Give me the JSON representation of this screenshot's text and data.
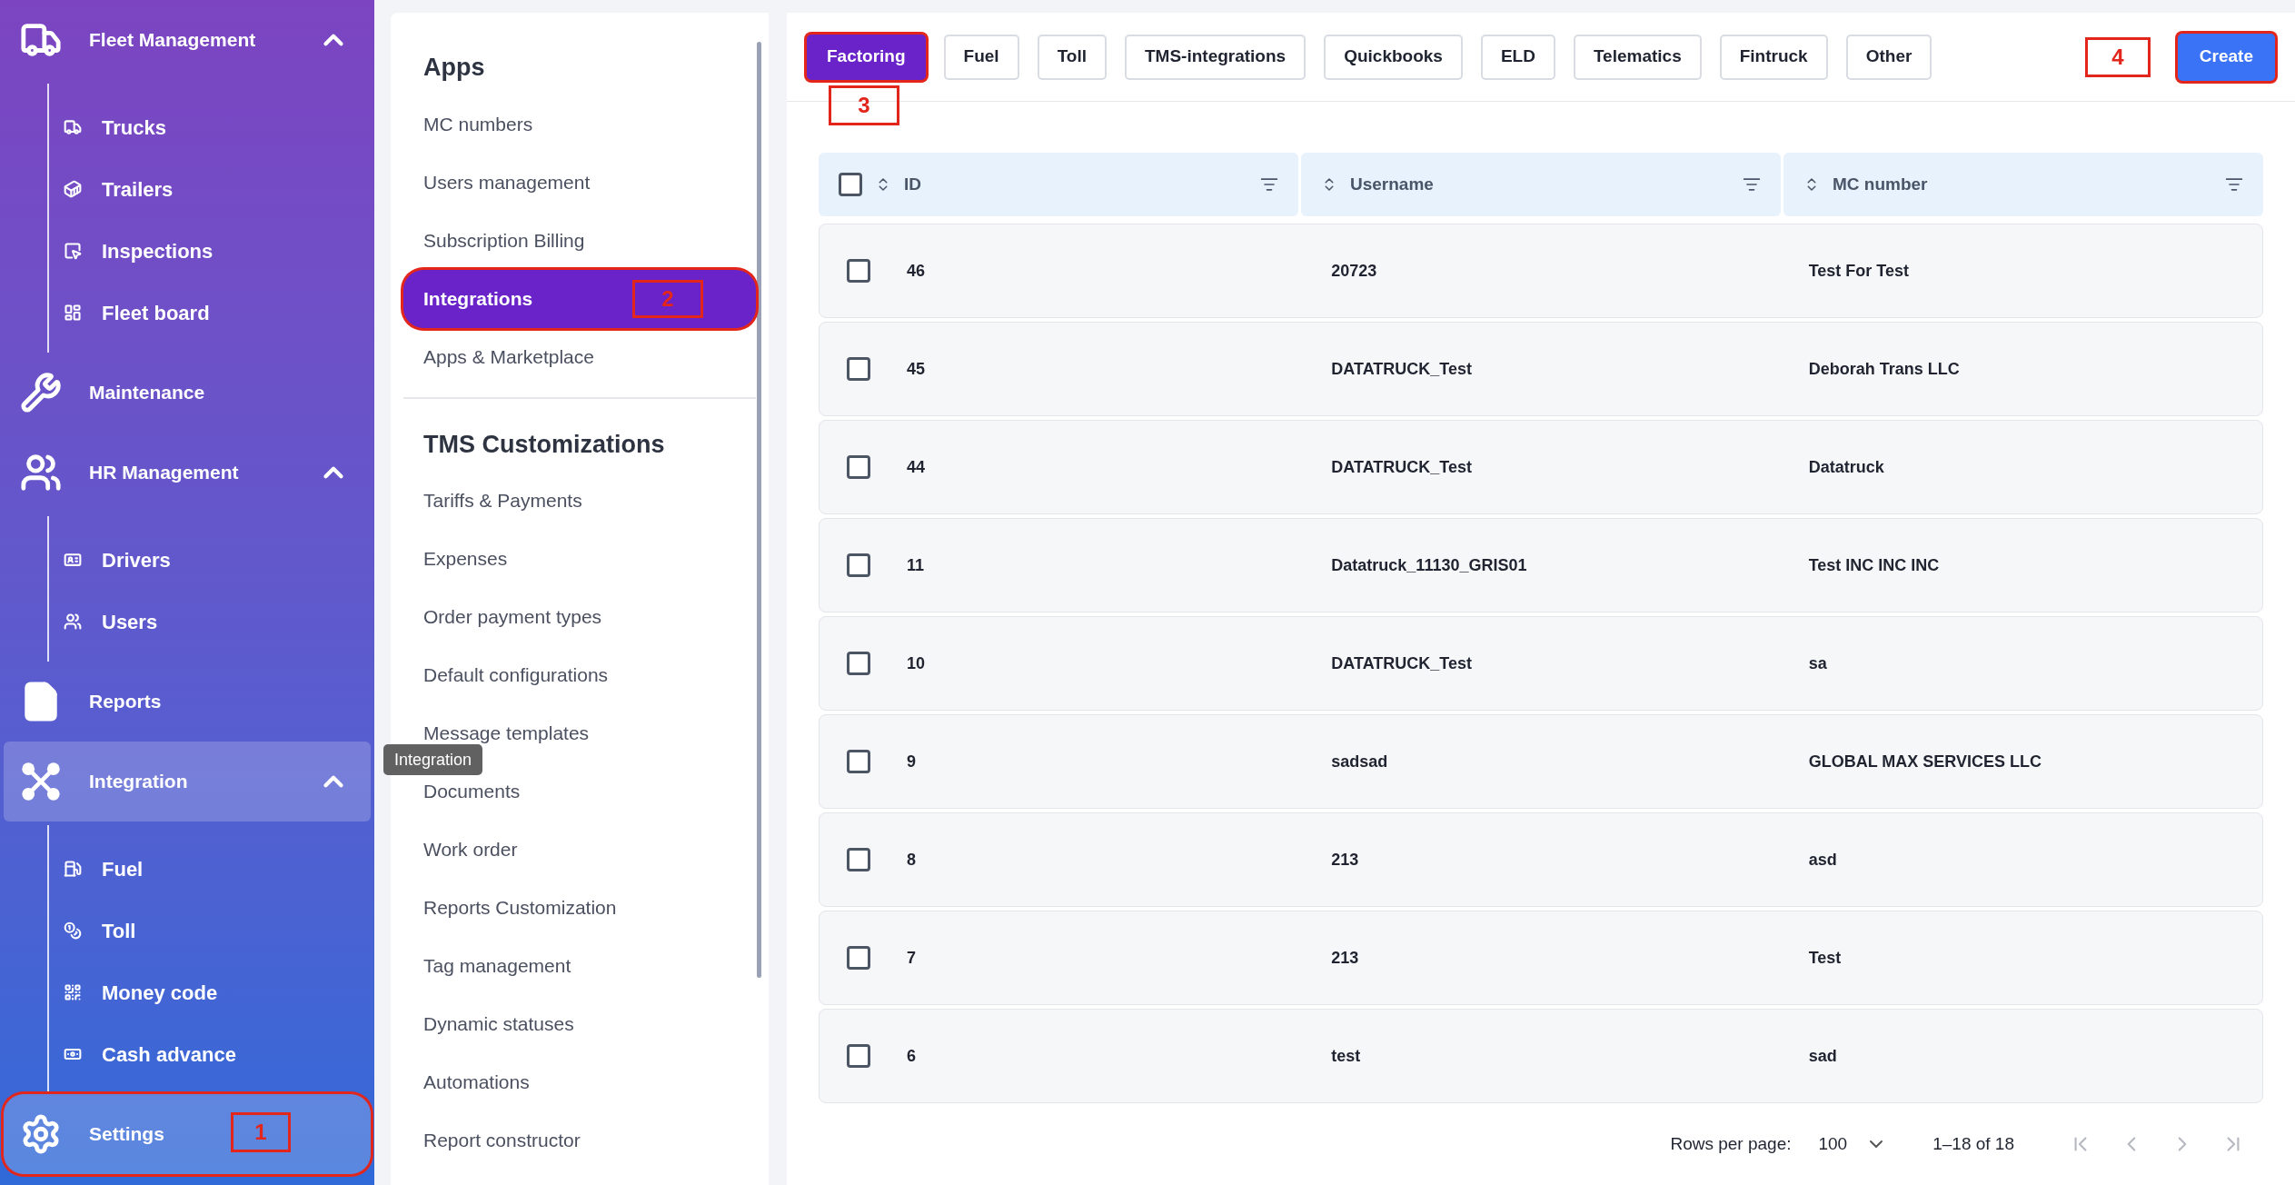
{
  "sidebar": {
    "items": [
      {
        "label": "Fleet Management",
        "kind": "group",
        "expanded": true,
        "selected": false,
        "children": [
          {
            "label": "Trucks"
          },
          {
            "label": "Trailers"
          },
          {
            "label": "Inspections"
          },
          {
            "label": "Fleet board"
          }
        ]
      },
      {
        "label": "Maintenance",
        "kind": "link",
        "selected": false
      },
      {
        "label": "HR Management",
        "kind": "group",
        "expanded": true,
        "selected": false,
        "children": [
          {
            "label": "Drivers"
          },
          {
            "label": "Users"
          }
        ]
      },
      {
        "label": "Reports",
        "kind": "link",
        "selected": false
      },
      {
        "label": "Integration",
        "kind": "group",
        "expanded": true,
        "selected": true,
        "tooltip": "Integration",
        "children": [
          {
            "label": "Fuel"
          },
          {
            "label": "Toll"
          },
          {
            "label": "Money code"
          },
          {
            "label": "Cash advance"
          }
        ]
      },
      {
        "label": "Settings",
        "kind": "link",
        "selected": true,
        "callout": "1"
      }
    ]
  },
  "settings_menu": {
    "sections": [
      {
        "title": "Apps",
        "items": [
          {
            "label": "MC numbers",
            "selected": false
          },
          {
            "label": "Users management",
            "selected": false
          },
          {
            "label": "Subscription Billing",
            "selected": false
          },
          {
            "label": "Integrations",
            "selected": true,
            "callout": "2"
          },
          {
            "label": "Apps & Marketplace",
            "selected": false
          }
        ]
      },
      {
        "title": "TMS Customizations",
        "items": [
          {
            "label": "Tariffs & Payments",
            "selected": false
          },
          {
            "label": "Expenses",
            "selected": false
          },
          {
            "label": "Order payment types",
            "selected": false
          },
          {
            "label": "Default configurations",
            "selected": false
          },
          {
            "label": "Message templates",
            "selected": false
          },
          {
            "label": "Documents",
            "selected": false
          },
          {
            "label": "Work order",
            "selected": false
          },
          {
            "label": "Reports Customization",
            "selected": false
          },
          {
            "label": "Tag management",
            "selected": false
          },
          {
            "label": "Dynamic statuses",
            "selected": false
          },
          {
            "label": "Automations",
            "selected": false
          },
          {
            "label": "Report constructor",
            "selected": false
          }
        ]
      }
    ]
  },
  "tabs": [
    {
      "label": "Factoring",
      "selected": true,
      "callout": "3"
    },
    {
      "label": "Fuel",
      "selected": false
    },
    {
      "label": "Toll",
      "selected": false
    },
    {
      "label": "TMS-integrations",
      "selected": false
    },
    {
      "label": "Quickbooks",
      "selected": false
    },
    {
      "label": "ELD",
      "selected": false
    },
    {
      "label": "Telematics",
      "selected": false
    },
    {
      "label": "Fintruck",
      "selected": false
    },
    {
      "label": "Other",
      "selected": false
    }
  ],
  "create_button": {
    "label": "Create",
    "callout": "4"
  },
  "table": {
    "all_checked": false,
    "columns": [
      "ID",
      "Username",
      "MC number"
    ],
    "rows": [
      {
        "checked": false,
        "cells": [
          "46",
          "20723",
          "Test For Test"
        ]
      },
      {
        "checked": false,
        "cells": [
          "45",
          "DATATRUCK_Test",
          "Deborah Trans LLC"
        ]
      },
      {
        "checked": false,
        "cells": [
          "44",
          "DATATRUCK_Test",
          "Datatruck"
        ]
      },
      {
        "checked": false,
        "cells": [
          "11",
          "Datatruck_11130_GRIS01",
          "Test INC INC INC"
        ]
      },
      {
        "checked": false,
        "cells": [
          "10",
          "DATATRUCK_Test",
          "sa"
        ]
      },
      {
        "checked": false,
        "cells": [
          "9",
          "sadsad",
          "GLOBAL MAX SERVICES LLC"
        ]
      },
      {
        "checked": false,
        "cells": [
          "8",
          "213",
          "asd"
        ]
      },
      {
        "checked": false,
        "cells": [
          "7",
          "213",
          "Test"
        ]
      },
      {
        "checked": false,
        "cells": [
          "6",
          "test",
          "sad"
        ]
      }
    ]
  },
  "pagination": {
    "rows_per_page_label": "Rows per page:",
    "rows_per_page": "100",
    "range": "1–18 of 18"
  }
}
